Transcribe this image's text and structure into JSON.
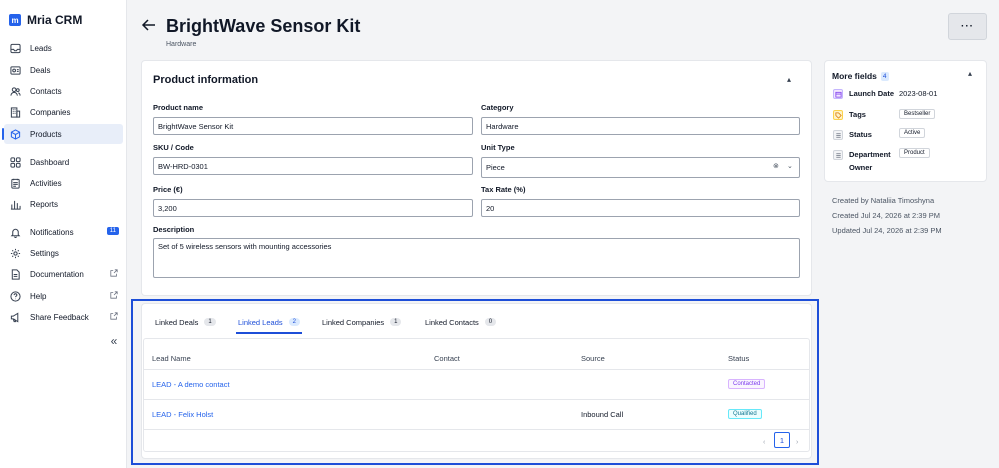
{
  "app": {
    "name": "Mria CRM",
    "logo_letter": "m"
  },
  "sidebar": {
    "items": [
      {
        "label": "Leads"
      },
      {
        "label": "Deals"
      },
      {
        "label": "Contacts"
      },
      {
        "label": "Companies"
      },
      {
        "label": "Products"
      },
      {
        "label": "Dashboard"
      },
      {
        "label": "Activities"
      },
      {
        "label": "Reports"
      },
      {
        "label": "Notifications",
        "badge": "11"
      },
      {
        "label": "Settings"
      },
      {
        "label": "Documentation"
      },
      {
        "label": "Help"
      },
      {
        "label": "Share Feedback"
      }
    ],
    "collapse_glyph": "«"
  },
  "header": {
    "title": "BrightWave Sensor Kit",
    "subtitle": "Hardware",
    "more_glyph": "···"
  },
  "product_info": {
    "title": "Product information",
    "fields": {
      "product_name": {
        "label": "Product name",
        "value": "BrightWave Sensor Kit"
      },
      "category": {
        "label": "Category",
        "value": "Hardware"
      },
      "sku": {
        "label": "SKU / Code",
        "value": "BW-HRD-0301"
      },
      "unit_type": {
        "label": "Unit Type",
        "value": "Piece"
      },
      "price": {
        "label": "Price (€)",
        "value": "3,200"
      },
      "tax_rate": {
        "label": "Tax Rate (%)",
        "value": "20"
      },
      "description": {
        "label": "Description",
        "value": "Set of 5 wireless sensors with mounting accessories"
      }
    }
  },
  "more_fields": {
    "title": "More fields",
    "count": "4",
    "rows": [
      {
        "label": "Launch Date",
        "value": "2023-08-01"
      },
      {
        "label": "Tags",
        "value": "Bestseller"
      },
      {
        "label": "Status",
        "value": "Active"
      },
      {
        "label_line1": "Department",
        "label_line2": "Owner",
        "value": "Product"
      }
    ]
  },
  "meta": {
    "created_by": "Created by Nataliia Timoshyna",
    "created": "Created Jul 24, 2026 at 2:39 PM",
    "updated": "Updated Jul 24, 2026 at 2:39 PM"
  },
  "linked": {
    "tabs": [
      {
        "label": "Linked Deals",
        "count": "1"
      },
      {
        "label": "Linked Leads",
        "count": "2"
      },
      {
        "label": "Linked Companies",
        "count": "1"
      },
      {
        "label": "Linked Contacts",
        "count": "0"
      }
    ],
    "columns": [
      "Lead Name",
      "Contact",
      "Source",
      "Status"
    ],
    "rows": [
      {
        "name": "LEAD - A demo contact",
        "contact": "",
        "source": "",
        "status": "Contacted"
      },
      {
        "name": "LEAD - Felix Holst",
        "contact": "",
        "source": "Inbound Call",
        "status": "Qualified"
      }
    ],
    "pagination": {
      "current": "1",
      "prev": "‹",
      "next": "›"
    }
  },
  "colors": {
    "accent": "#2563eb",
    "highlight_border": "#1d4ed8",
    "contacted": "#7c3aed",
    "qualified": "#0e7490"
  }
}
